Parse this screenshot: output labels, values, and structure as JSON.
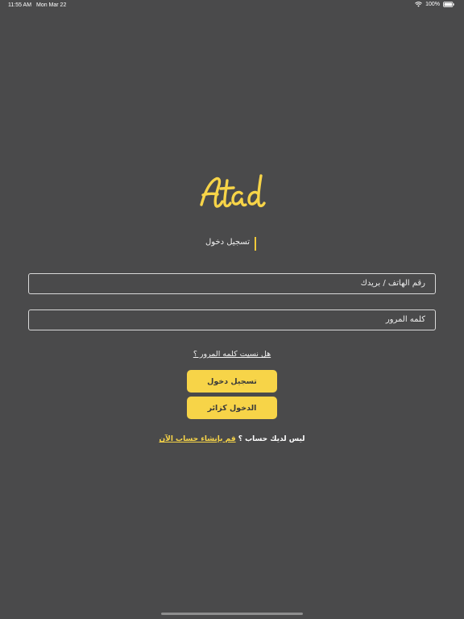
{
  "status_bar": {
    "time": "11:55 AM",
    "date": "Mon Mar 22",
    "battery_percent": "100%"
  },
  "logo": {
    "text": "Atad",
    "color": "#f7d448"
  },
  "page_tab": {
    "label": "تسجيل دخول"
  },
  "form": {
    "phone_placeholder": "رقم الهاتف / بريدك",
    "password_placeholder": "كلمه المرور",
    "forgot_password": "هل نسيت كلمه المرور ؟"
  },
  "buttons": {
    "login": "تسجيل دخول",
    "guest": "الدخول كزائر"
  },
  "signup": {
    "prompt": "ليس لديك حساب ؟",
    "link": "قم بإنشاء حساب الآن"
  },
  "colors": {
    "background": "#4a4a4b",
    "accent": "#f7d448"
  }
}
